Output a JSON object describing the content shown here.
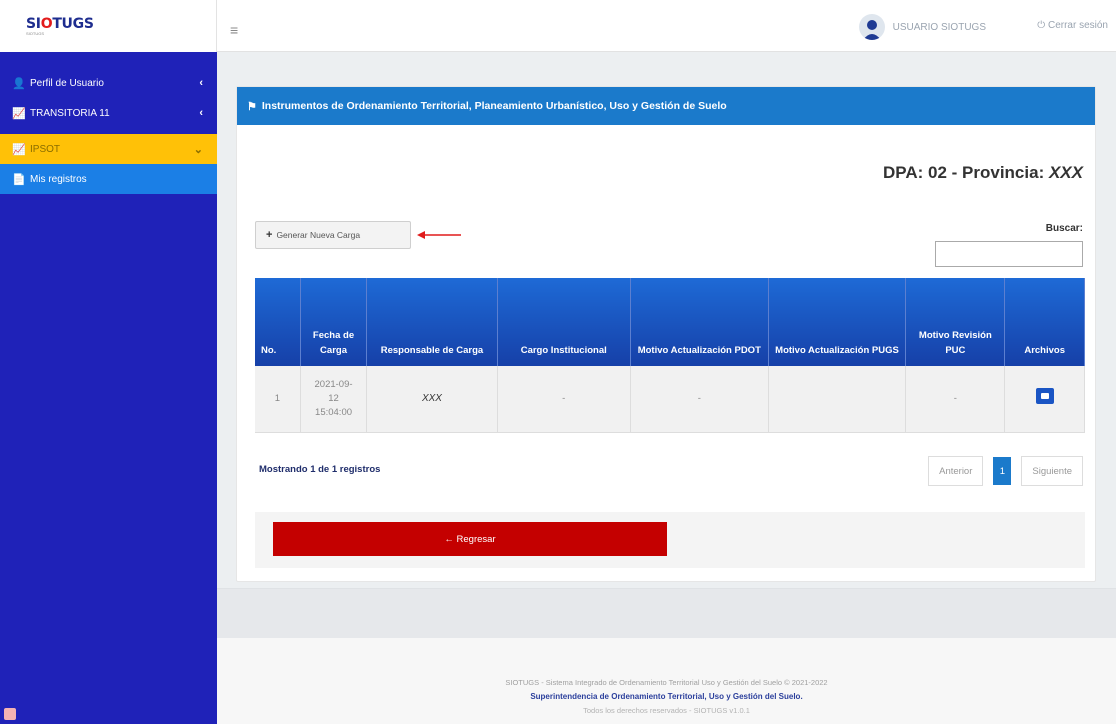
{
  "app": {
    "brand_prefix": "SI",
    "brand_o": "O",
    "brand_suffix": "TUGS",
    "brand_tagline": "SIOTUGS"
  },
  "sidebar": {
    "items": [
      {
        "label": "Perfil de Usuario",
        "icon": "user-icon",
        "chevron": "‹"
      },
      {
        "label": "TRANSITORIA 11",
        "icon": "chart-icon",
        "chevron": "‹"
      },
      {
        "label": "IPSOT",
        "icon": "chart-icon",
        "chevron": "⌄"
      },
      {
        "label": "Mis registros",
        "icon": "file-icon"
      }
    ]
  },
  "topbar": {
    "menu_icon": "≡",
    "user_name": "USUARIO SIOTUGS",
    "logout_label": "Cerrar sesión"
  },
  "card": {
    "title": "Instrumentos de Ordenamiento Territorial, Planeamiento Urbanístico, Uso y Gestión de Suelo",
    "dpa_prefix": "DPA: 02 - Provincia:",
    "dpa_value": "XXX",
    "generate_button": "Generar Nueva Carga",
    "search_label": "Buscar:",
    "search_value": ""
  },
  "table": {
    "headers": [
      "No.",
      "Fecha de Carga",
      "Responsable de Carga",
      "Cargo Institucional",
      "Motivo Actualización PDOT",
      "Motivo Actualización PUGS",
      "Motivo Revisión PUC",
      "Archivos"
    ],
    "rows": [
      {
        "no": "1",
        "fecha_date": "2021-09-",
        "fecha_day": "12",
        "fecha_time": "15:04:00",
        "responsable": "XXX",
        "cargo": "-",
        "pdot": "-",
        "pugs": "",
        "puc": "-"
      }
    ]
  },
  "pagination": {
    "showing": "Mostrando 1 de 1 registros",
    "prev": "Anterior",
    "current": "1",
    "next": "Siguiente"
  },
  "back_button": "Regresar",
  "footer": {
    "line1": "SIOTUGS - Sistema Integrado de Ordenamiento Territorial Uso y Gestión del Suelo © 2021-2022",
    "line2": "Superintendencia de Ordenamiento Territorial, Uso y Gestión del Suelo.",
    "line3": "Todos los derechos reservados - SIOTUGS v1.0.1"
  },
  "colors": {
    "sidebar": "#1f22b8",
    "active": "#ffc107",
    "submenu": "#1b7fe6",
    "header": "#1b7acb",
    "back": "#c40000"
  }
}
